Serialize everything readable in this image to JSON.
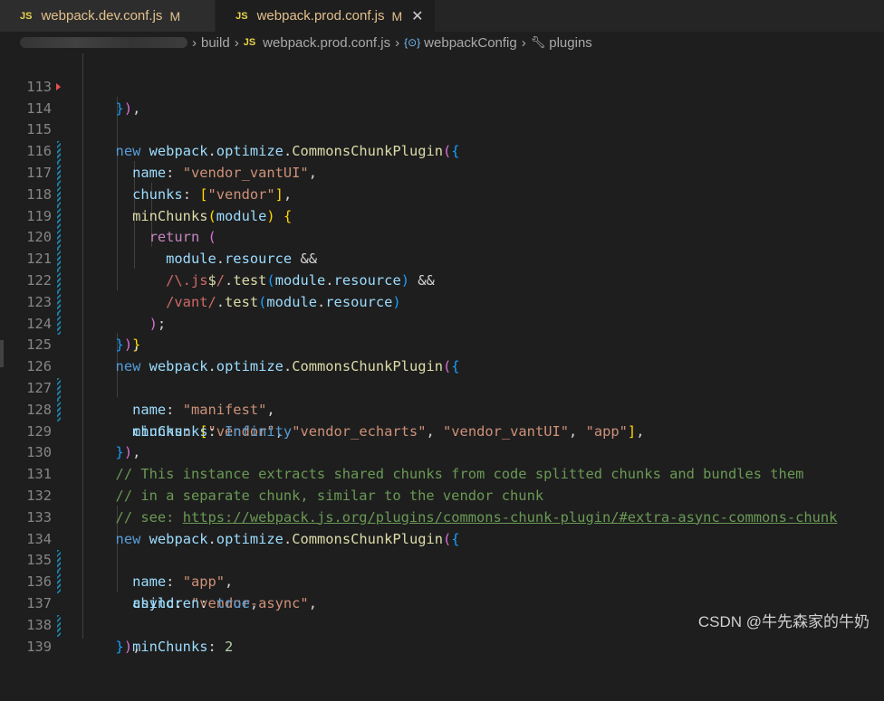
{
  "tabs": [
    {
      "badge": "JS",
      "name": "webpack.dev.conf.js",
      "status": "M",
      "active": false
    },
    {
      "badge": "JS",
      "name": "webpack.prod.conf.js",
      "status": "M",
      "active": true,
      "close": "✕"
    }
  ],
  "breadcrumb": {
    "folder": "build",
    "file_badge": "JS",
    "file": "webpack.prod.conf.js",
    "symbol_icon": "{⊙}",
    "symbol": "webpackConfig",
    "member": "plugins"
  },
  "line_numbers": [
    "113",
    "114",
    "115",
    "116",
    "117",
    "118",
    "119",
    "120",
    "121",
    "122",
    "123",
    "124",
    "125",
    "126",
    "127",
    "128",
    "129",
    "130",
    "131",
    "132",
    "133",
    "134",
    "135",
    "136",
    "137",
    "138",
    "139"
  ],
  "watermark": "CSDN @牛先森家的牛奶",
  "colors": {
    "background": "#1e1e1e",
    "keyword": "#569cd6",
    "string": "#ce9178",
    "comment": "#6a9955",
    "variable": "#9cdcfe",
    "function": "#dcdcaa"
  }
}
